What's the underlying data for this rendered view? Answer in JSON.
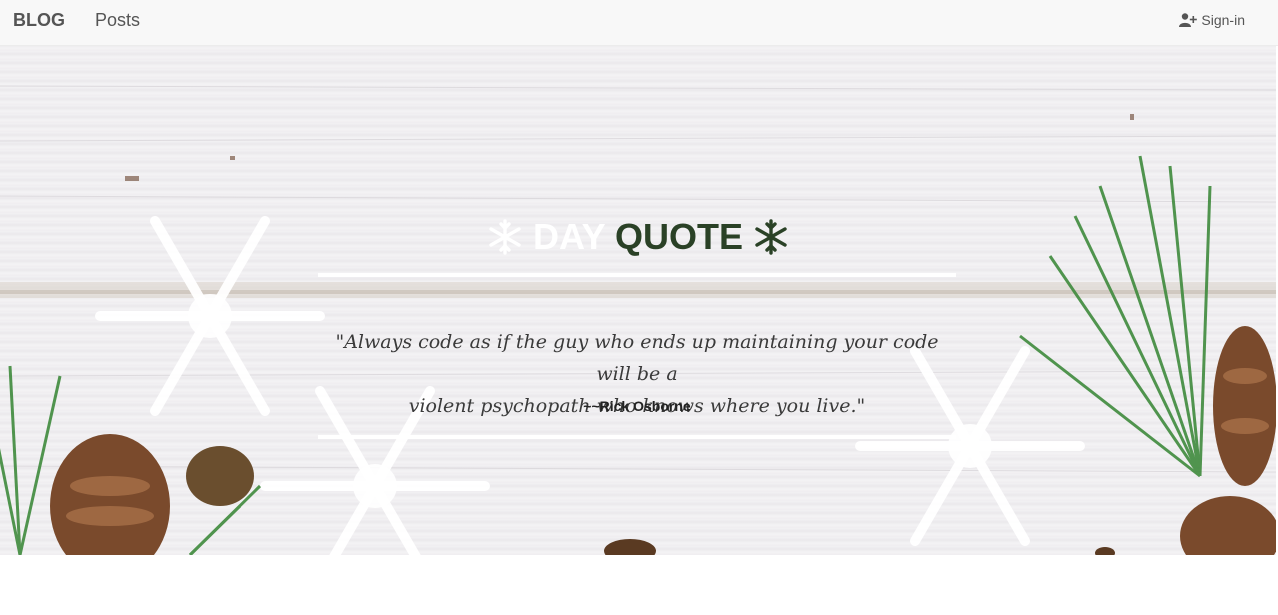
{
  "navbar": {
    "brand": "BLOG",
    "posts_link": "Posts",
    "signin_label": "Sign-in",
    "signin_icon": "user-plus-icon"
  },
  "hero": {
    "title_part1": "DAY",
    "title_part2": "QUOTE",
    "title_icon": "snowflake-icon",
    "quote_line1": "\"Always code as if the guy who ends up maintaining your code will be a",
    "quote_line2": "violent psychopath who knows where you live.\"",
    "author": "~~Rick Osborne",
    "colors": {
      "accent_green": "#2a4126",
      "title_white": "#ffffff"
    }
  }
}
